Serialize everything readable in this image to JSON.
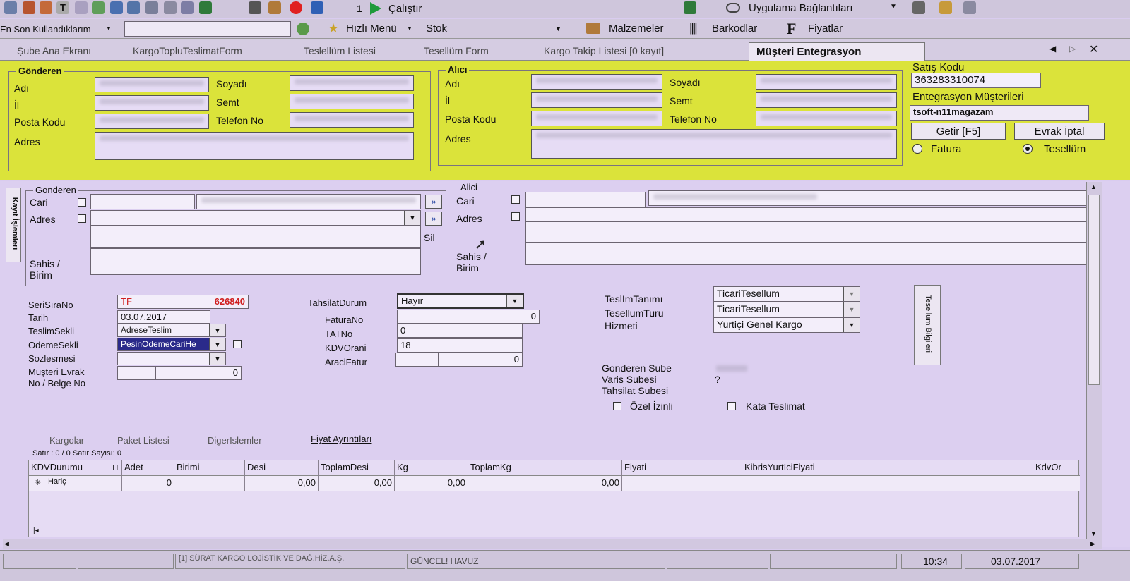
{
  "toolbar": {
    "counter": "1",
    "run_label": "Çalıştır",
    "app_links_label": "Uygulama Bağlantıları"
  },
  "menubar": {
    "recent": "En Son Kullandıklarım",
    "search_value": "",
    "quick_menu": "Hızlı Menü",
    "stok": "Stok",
    "malzemeler": "Malzemeler",
    "barkodlar": "Barkodlar",
    "fiyatlar": "Fiyatlar"
  },
  "tabs": [
    {
      "label": "Şube Ana Ekranı"
    },
    {
      "label": "KargoTopluTeslimatForm"
    },
    {
      "label": "Teslellüm Listesi"
    },
    {
      "label": "Tesellüm Form"
    },
    {
      "label": "Kargo Takip Listesi [0 kayıt]"
    },
    {
      "label": "Müşteri Entegrasyon"
    }
  ],
  "yellow": {
    "gonderen": {
      "title": "Gönderen",
      "adi": "Adı",
      "soyadi": "Soyadı",
      "il": "İl",
      "semt": "Semt",
      "posta": "Posta Kodu",
      "telefon": "Telefon No",
      "adres": "Adres"
    },
    "alici": {
      "title": "Alıcı",
      "adi": "Adı",
      "soyadi": "Soyadı",
      "il": "İl",
      "semt": "Semt",
      "posta": "Posta Kodu",
      "telefon": "Telefon No",
      "adres": "Adres"
    },
    "satis_kodu_label": "Satış Kodu",
    "satis_kodu": "363283310074",
    "entegrasyon_label": "Entegrasyon Müşterileri",
    "entegrasyon_value": "tsoft-n11magazam",
    "getir": "Getir [F5]",
    "evrak_iptal": "Evrak İptal",
    "fatura": "Fatura",
    "tesellum": "Tesellüm"
  },
  "side_tab": "Kayıt İşlemleri",
  "gonderen2": {
    "title": "Gonderen",
    "cari": "Cari",
    "adres": "Adres",
    "sahis": "Sahis /",
    "birim": "Birim",
    "sil": "Sil",
    "go": "»"
  },
  "alici2": {
    "title": "Alici",
    "cari": "Cari",
    "adres": "Adres",
    "sahis": "Sahis /",
    "birim": "Birim"
  },
  "form": {
    "seri_label": "SeriSıraNo",
    "seri_prefix": "TF",
    "seri_no": "626840",
    "tarih_label": "Tarih",
    "tarih": "03.07.2017",
    "teslim_label": "TeslimSekli",
    "teslim": "AdreseTeslim",
    "odeme_label": "OdemeSekli",
    "odeme": "PesinOdemeCariHe",
    "sozlesme_label": "Sozlesmesi",
    "musteri_label1": "Muşteri Evrak",
    "musteri_label2": "No / Belge No",
    "musteri_val": "0",
    "tahsilat_label": "TahsilatDurum",
    "tahsilat": "Hayır",
    "fatura_label": "FaturaNo",
    "fatura_val": "0",
    "tat_label": "TATNo",
    "tat_val": "0",
    "kdv_label": "KDVOrani",
    "kdv_val": "18",
    "araci_label": "AraciFatur",
    "araci_val": "0",
    "teslim_tanimi_label": "TeslImTanımı",
    "teslim_tanimi": "TicariTesellum",
    "tesellum_turu_label": "TesellumTuru",
    "tesellum_turu": "TicariTesellum",
    "hizmeti_label": "Hizmeti",
    "hizmeti": "Yurtiçi Genel Kargo",
    "gonderen_sube": "Gonderen Sube",
    "varis_subesi": "Varis Subesi",
    "varis_val": "?",
    "tahsilat_subesi": "Tahsilat Subesi",
    "ozel_izinli": "Özel İzinli",
    "kata_teslimat": "Kata Teslimat",
    "tesellum_bilgileri": "Tesellum Bilgileri"
  },
  "bottom_tabs": [
    {
      "label": "Kargolar"
    },
    {
      "label": "Paket Listesi"
    },
    {
      "label": "DigerIslemler"
    },
    {
      "label": "Fiyat Ayrıntıları"
    }
  ],
  "grid": {
    "status": "Satır : 0 / 0 Satır Sayısı: 0",
    "columns": [
      "KDVDurumu",
      "Adet",
      "Birimi",
      "Desi",
      "ToplamDesi",
      "Kg",
      "ToplamKg",
      "Fiyati",
      "KibrisYurtIciFiyati",
      "KdvOr"
    ],
    "row": {
      "kdv": "Hariç",
      "adet": "0",
      "birimi": "",
      "desi": "0,00",
      "toplam_desi": "0,00",
      "kg": "0,00",
      "toplam_kg": "0,00"
    }
  },
  "statusbar": {
    "company": "[1] SÜRAT KARGO LOJİSTİK VE DAĞ.HİZ.A.Ş.",
    "pool": "GÜNCEL! HAVUZ",
    "time": "10:34",
    "date": "03.07.2017"
  }
}
